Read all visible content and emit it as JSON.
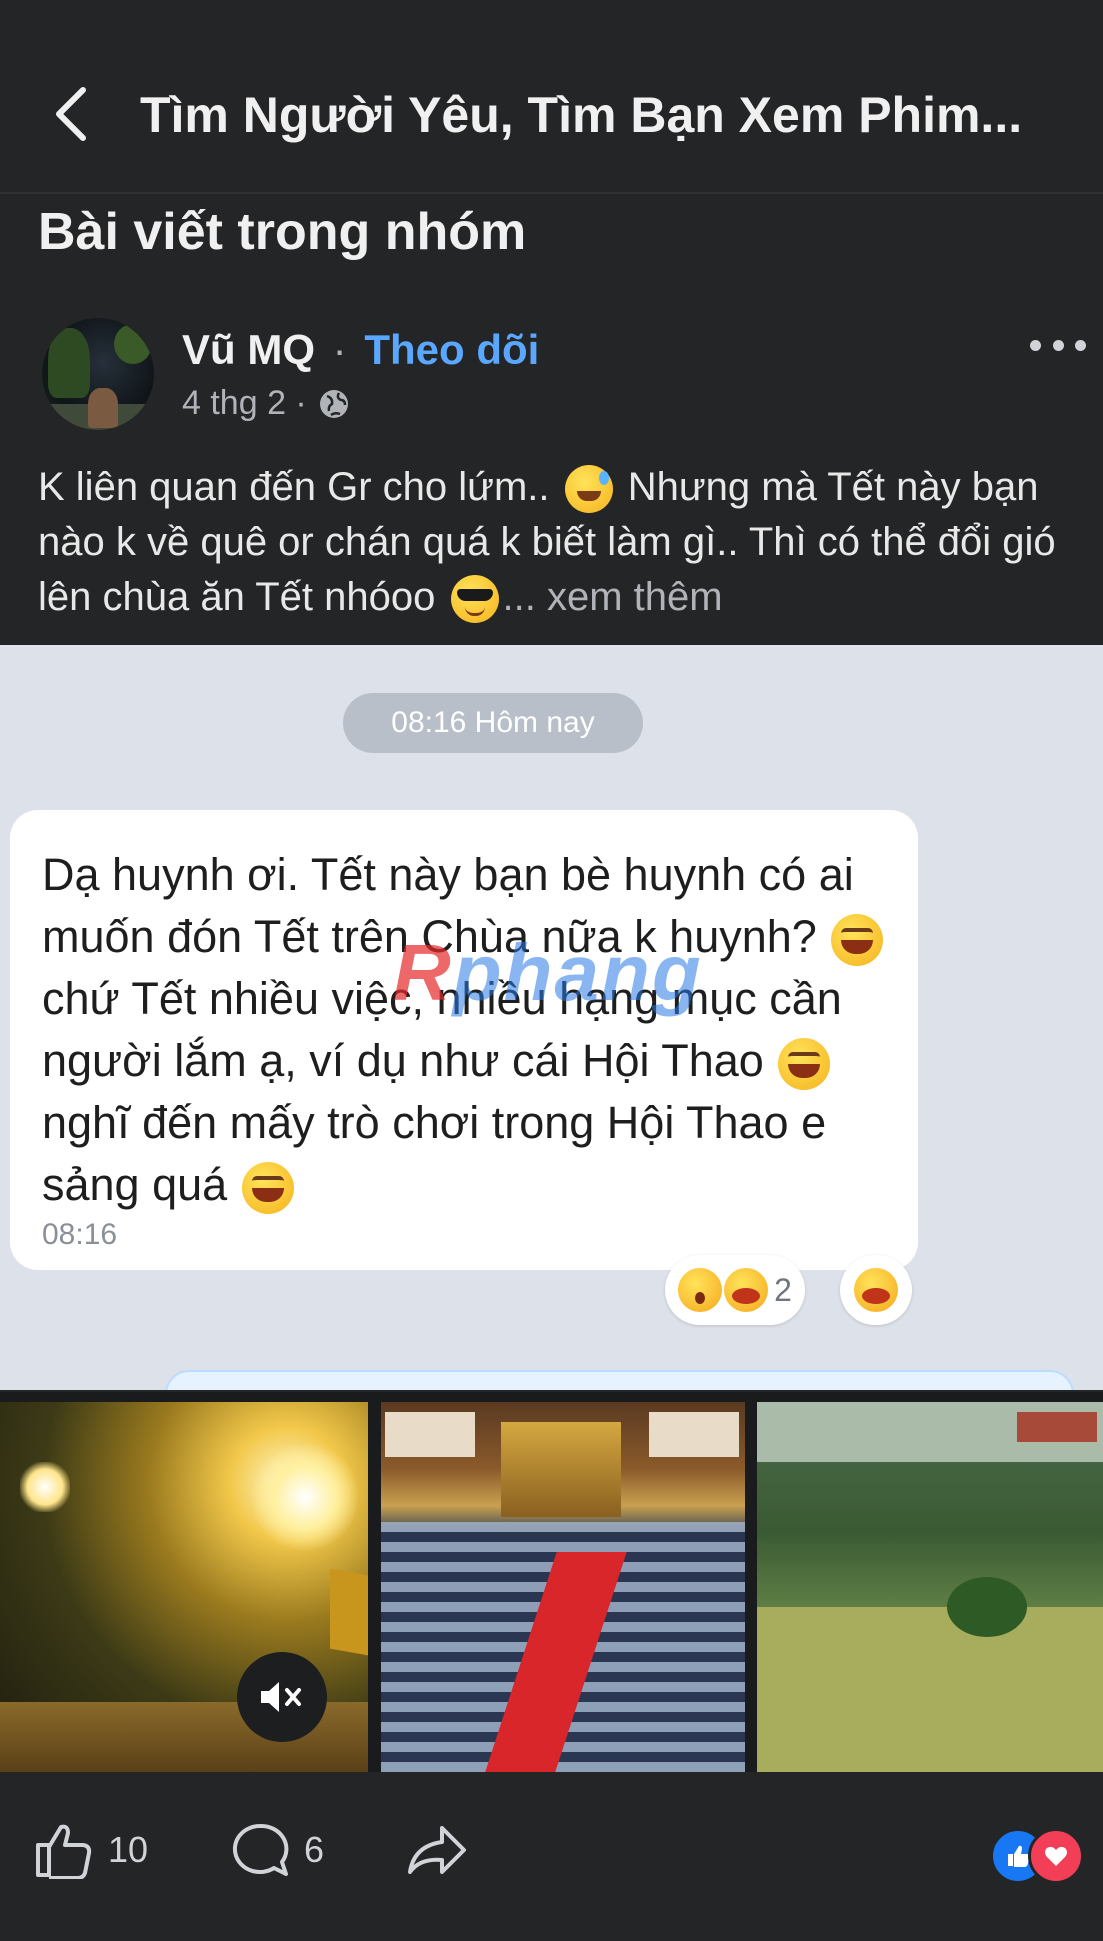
{
  "header": {
    "back_icon": "chevron-left-icon",
    "title": "Tìm Người Yêu, Tìm Bạn Xem Phim..."
  },
  "section": {
    "title": "Bài viết trong nhóm"
  },
  "post": {
    "author": "Vũ MQ",
    "separator": "·",
    "follow_label": "Theo dõi",
    "time": "4 thg 2 ·",
    "privacy_icon": "globe-icon",
    "text_part1": "K liên quan đến Gr cho lứm..",
    "text_part2": "Nhưng mà Tết này bạn nào k về quê or chán quá k biết làm gì.. Thì có thể đổi gió lên chùa ăn Tết nhóoo",
    "text_ellipsis": "...",
    "see_more": "xem thêm"
  },
  "chat": {
    "time_chip": "08:16 Hôm nay",
    "message_line1": "Dạ huynh ơi. Tết này bạn bè huynh có ai muốn đón Tết trên Chùa nữa k huynh?",
    "message_line2": "chứ Tết nhiều việc, nhiều hạng mục cần người lắm ạ, ví dụ như cái Hội Thao",
    "message_line3": "nghĩ đến mấy trò chơi trong Hội Thao e sảng quá",
    "message_time": "08:16",
    "reaction_count": "2",
    "watermark": "Rphang"
  },
  "actions": {
    "like_count": "10",
    "comment_count": "6"
  },
  "colors": {
    "background": "#242526",
    "link_blue": "#5aa7ff",
    "chat_bg": "#dde2ea",
    "like_blue": "#1877f2",
    "love_red": "#f33e58"
  }
}
